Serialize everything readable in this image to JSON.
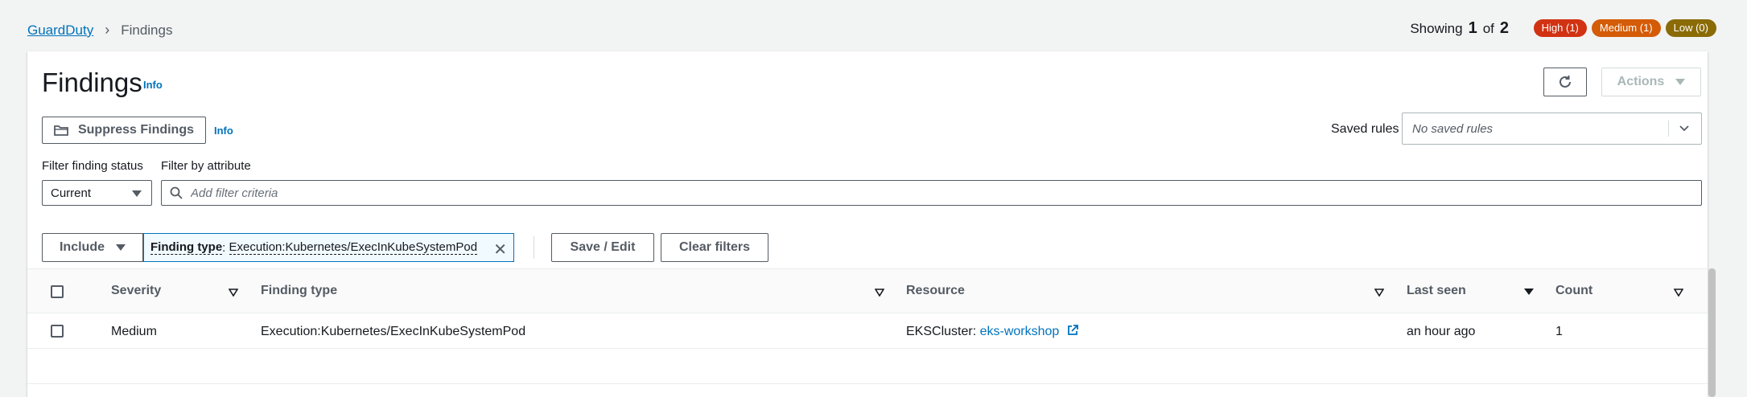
{
  "breadcrumb": {
    "root": "GuardDuty",
    "current": "Findings"
  },
  "showing": {
    "prefix": "Showing",
    "current": "1",
    "of": "of",
    "total": "2"
  },
  "severity_badges": {
    "high": "High (1)",
    "medium": "Medium (1)",
    "low": "Low (0)",
    "colors": {
      "high": "#d13212",
      "medium": "#d45b07",
      "low": "#8a6b05"
    }
  },
  "header": {
    "title": "Findings",
    "info": "Info",
    "actions_label": "Actions"
  },
  "suppress": {
    "label": "Suppress Findings",
    "info": "Info"
  },
  "saved_rules": {
    "label": "Saved rules",
    "placeholder": "No saved rules"
  },
  "filters": {
    "status_label": "Filter finding status",
    "status_value": "Current",
    "attribute_label": "Filter by attribute",
    "attribute_placeholder": "Add filter criteria",
    "include_label": "Include",
    "token_key": "Finding type",
    "token_sep": ": ",
    "token_value": "Execution:Kubernetes/ExecInKubeSystemPod",
    "save_label": "Save / Edit",
    "clear_label": "Clear filters"
  },
  "table": {
    "columns": [
      "Severity",
      "Finding type",
      "Resource",
      "Last seen",
      "Count"
    ],
    "rows": [
      {
        "severity": "Medium",
        "finding_type": "Execution:Kubernetes/ExecInKubeSystemPod",
        "resource_prefix": "EKSCluster: ",
        "resource_link": "eks-workshop",
        "last_seen": "an hour ago",
        "count": "1"
      }
    ]
  },
  "icons": {
    "refresh": "refresh-icon",
    "folder": "folder-icon",
    "search": "search-icon",
    "external": "external-link-icon",
    "close": "close-icon"
  }
}
